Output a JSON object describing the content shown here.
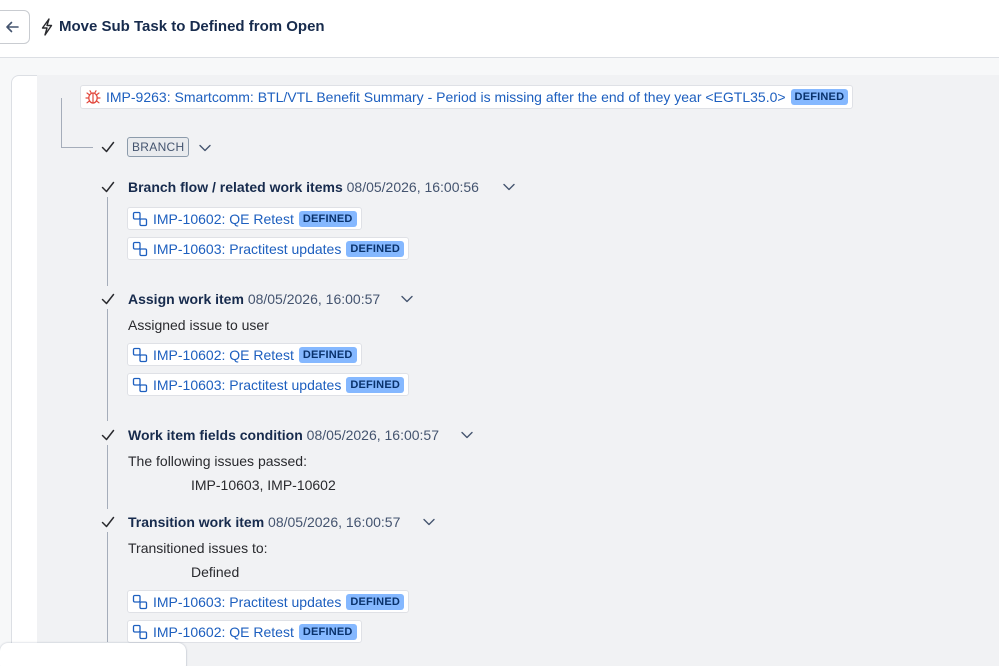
{
  "header": {
    "back_icon": "arrow-left-icon",
    "bolt_icon": "lightning-bolt-icon",
    "title": "Move Sub Task to Defined from Open"
  },
  "colors": {
    "link": "#1d5fbf",
    "lozenge_bg": "#85b8ff",
    "bug_icon": "#e2483d"
  },
  "trigger": {
    "icon": "bug-icon",
    "issue": "IMP-9263: Smartcomm: BTL/VTL Benefit Summary - Period is missing after the end of they year <EGTL35.0>",
    "status": "DEFINED"
  },
  "branch": {
    "label": "BRANCH"
  },
  "steps": [
    {
      "title": "Branch flow / related work items",
      "timestamp": "08/05/2026, 16:00:56",
      "issues": [
        {
          "key": "IMP-10602: QE Retest",
          "status": "DEFINED"
        },
        {
          "key": "IMP-10603: Practitest updates",
          "status": "DEFINED"
        }
      ]
    },
    {
      "title": "Assign work item",
      "timestamp": "08/05/2026, 16:00:57",
      "detail": "Assigned issue to user",
      "issues": [
        {
          "key": "IMP-10602: QE Retest",
          "status": "DEFINED"
        },
        {
          "key": "IMP-10603: Practitest updates",
          "status": "DEFINED"
        }
      ]
    },
    {
      "title": "Work item fields condition",
      "timestamp": "08/05/2026, 16:00:57",
      "detail": "The following issues passed:",
      "sub_detail": "IMP-10603, IMP-10602"
    },
    {
      "title": "Transition work item",
      "timestamp": "08/05/2026, 16:00:57",
      "detail": "Transitioned issues to:",
      "sub_detail": "Defined",
      "issues": [
        {
          "key": "IMP-10603: Practitest updates",
          "status": "DEFINED"
        },
        {
          "key": "IMP-10602: QE Retest",
          "status": "DEFINED"
        }
      ]
    }
  ]
}
